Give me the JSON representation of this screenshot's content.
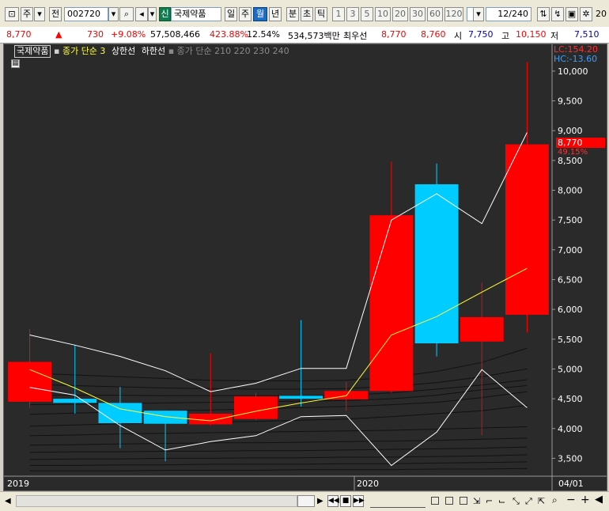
{
  "toolbar": {
    "period_label": "주",
    "prev_label": "전",
    "code": "002720",
    "name_badge": "신",
    "stock_name": "국제약품",
    "periods": [
      "일",
      "주",
      "월",
      "년"
    ],
    "selected_period": "월",
    "minute_buttons": [
      "분",
      "초",
      "틱"
    ],
    "intervals": [
      "1",
      "3",
      "5",
      "10",
      "20",
      "30",
      "60",
      "120"
    ],
    "count": "12/240",
    "right_stub": "20"
  },
  "quote": {
    "price": "8,770",
    "arrow": "▲",
    "change": "730",
    "change_pct": "+9.08%",
    "volume": "57,508,466",
    "volume_pct": "423.88%",
    "turnover": "12.54%",
    "amount": "534,573백만",
    "best_ask_label": "최우선",
    "best_ask": "8,770",
    "best_bid": "8,760",
    "open_label": "시",
    "open": "7,750",
    "high_label": "고",
    "high": "10,150",
    "low_label": "저",
    "low": "7,510"
  },
  "legend": {
    "name": "국제약품",
    "ma_label": "종가 단순 3",
    "upper_label": "상한선",
    "lower_label": "하한선",
    "ma_long_label": "종가 단순 210  220  230  240"
  },
  "corner": {
    "lc": "LC:154.20",
    "hc": "HC:-13.60",
    "price_tag": "8,770",
    "pct_tag": "49.15%",
    "date_tag": "04/01"
  },
  "colors": {
    "up": "#ff0000",
    "down": "#00ccff",
    "ma": "#ffff33",
    "band": "#ffffff",
    "background": "#2a2a2a"
  },
  "chart_data": {
    "type": "candlestick",
    "x_labels": [
      "2019",
      "2020"
    ],
    "ylim": [
      3200,
      10450
    ],
    "y_ticks": [
      3500,
      4000,
      4500,
      5000,
      5500,
      6000,
      6500,
      7000,
      7500,
      8000,
      8500,
      9000,
      9500,
      10000
    ],
    "candles": [
      {
        "open": 4450,
        "high": 5670,
        "low": 4350,
        "close": 5120
      },
      {
        "open": 4500,
        "high": 5400,
        "low": 4250,
        "close": 4430
      },
      {
        "open": 4430,
        "high": 4700,
        "low": 3670,
        "close": 4090
      },
      {
        "open": 4300,
        "high": 4300,
        "low": 3450,
        "close": 4080
      },
      {
        "open": 4070,
        "high": 5260,
        "low": 4050,
        "close": 4250
      },
      {
        "open": 4160,
        "high": 4600,
        "low": 4140,
        "close": 4540
      },
      {
        "open": 4550,
        "high": 5820,
        "low": 4370,
        "close": 4500
      },
      {
        "open": 4490,
        "high": 4780,
        "low": 4300,
        "close": 4630
      },
      {
        "open": 4630,
        "high": 8480,
        "low": 4600,
        "close": 7580
      },
      {
        "open": 8100,
        "high": 8450,
        "low": 5210,
        "close": 5430
      },
      {
        "open": 5460,
        "high": 6450,
        "low": 3890,
        "close": 5870
      },
      {
        "open": 5910,
        "high": 10150,
        "low": 5610,
        "close": 8770
      }
    ],
    "ma3": [
      4990,
      4680,
      4330,
      4200,
      4130,
      4290,
      4430,
      4550,
      5570,
      5880,
      6290,
      6690
    ],
    "upper_band": [
      5570,
      5400,
      5210,
      4970,
      4620,
      4760,
      5010,
      5010,
      7500,
      7940,
      7440,
      8970
    ],
    "lower_band": [
      4690,
      4560,
      4050,
      3640,
      3780,
      3880,
      4200,
      4220,
      3380,
      3940,
      4990,
      4350
    ],
    "long_mas": [
      [
        4240,
        4260,
        4280,
        4300,
        4310,
        4330,
        4350,
        4370,
        4400,
        4440,
        4520,
        4620
      ],
      [
        4400,
        4410,
        4420,
        4430,
        4440,
        4450,
        4460,
        4470,
        4500,
        4560,
        4650,
        4720
      ],
      [
        4560,
        4560,
        4560,
        4550,
        4550,
        4550,
        4550,
        4560,
        4600,
        4660,
        4730,
        4820
      ],
      [
        4740,
        4720,
        4700,
        4680,
        4670,
        4660,
        4660,
        4670,
        4710,
        4770,
        4870,
        5000
      ],
      [
        4930,
        4900,
        4870,
        4840,
        4810,
        4800,
        4800,
        4810,
        4860,
        4960,
        5110,
        5350
      ],
      [
        4040,
        4060,
        4080,
        4090,
        4110,
        4120,
        4140,
        4160,
        4200,
        4250,
        4300,
        4390
      ],
      [
        3880,
        3890,
        3910,
        3920,
        3930,
        3940,
        3950,
        3960,
        3970,
        3990,
        4010,
        4030
      ],
      [
        3720,
        3730,
        3740,
        3750,
        3760,
        3760,
        3770,
        3780,
        3790,
        3800,
        3820,
        3840
      ],
      [
        3600,
        3610,
        3610,
        3620,
        3620,
        3630,
        3630,
        3640,
        3650,
        3660,
        3670,
        3690
      ],
      [
        3480,
        3490,
        3490,
        3500,
        3500,
        3510,
        3510,
        3520,
        3520,
        3530,
        3540,
        3560
      ],
      [
        3380,
        3380,
        3390,
        3390,
        3400,
        3400,
        3400,
        3410,
        3410,
        3420,
        3430,
        3440
      ],
      [
        3290,
        3290,
        3290,
        3300,
        3300,
        3300,
        3310,
        3310,
        3310,
        3320,
        3320,
        3330
      ]
    ]
  }
}
